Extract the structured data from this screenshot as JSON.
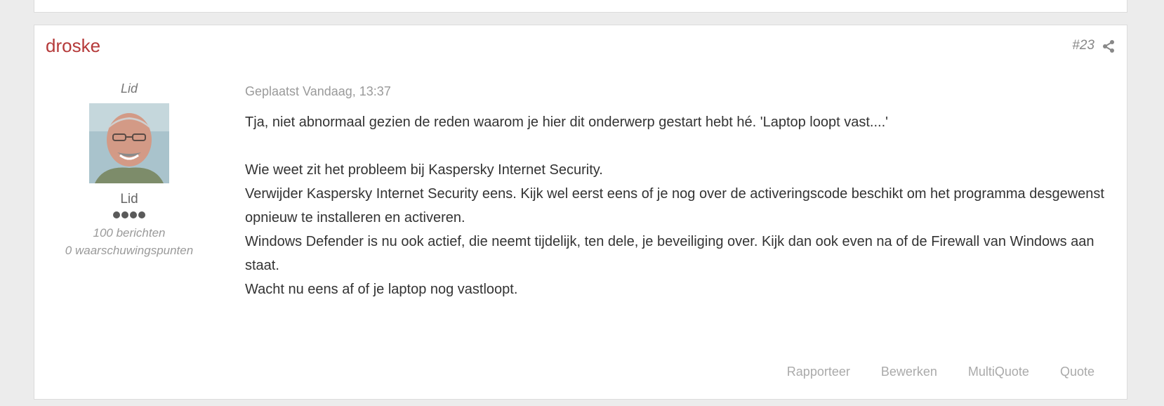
{
  "post": {
    "author": "droske",
    "number": "#23",
    "author_title": "Lid",
    "rank": "Lid",
    "rank_pips": 4,
    "post_count": "100 berichten",
    "warning_points": "0 waarschuwingspunten",
    "posted": "Geplaatst Vandaag, 13:37",
    "paragraphs": [
      "Tja, niet abnormaal gezien de reden waarom je hier dit onderwerp gestart hebt hé. 'Laptop loopt vast....'",
      "",
      "Wie weet zit het probleem bij Kaspersky Internet Security.",
      "Verwijder Kaspersky Internet Security eens. Kijk wel eerst eens of je nog over de activeringscode beschikt om het programma desgewenst opnieuw te installeren en activeren.",
      "Windows Defender is nu ook actief, die neemt tijdelijk, ten dele, je beveiliging over. Kijk dan ook even na of de Firewall van Windows aan staat.",
      "Wacht nu eens af of je laptop nog vastloopt."
    ],
    "actions": {
      "report": "Rapporteer",
      "edit": "Bewerken",
      "multiquote": "MultiQuote",
      "quote": "Quote"
    }
  },
  "colors": {
    "author_link": "#b53a3a",
    "background": "#ececec",
    "card": "#ffffff"
  },
  "icons": {
    "share": "share-icon"
  }
}
